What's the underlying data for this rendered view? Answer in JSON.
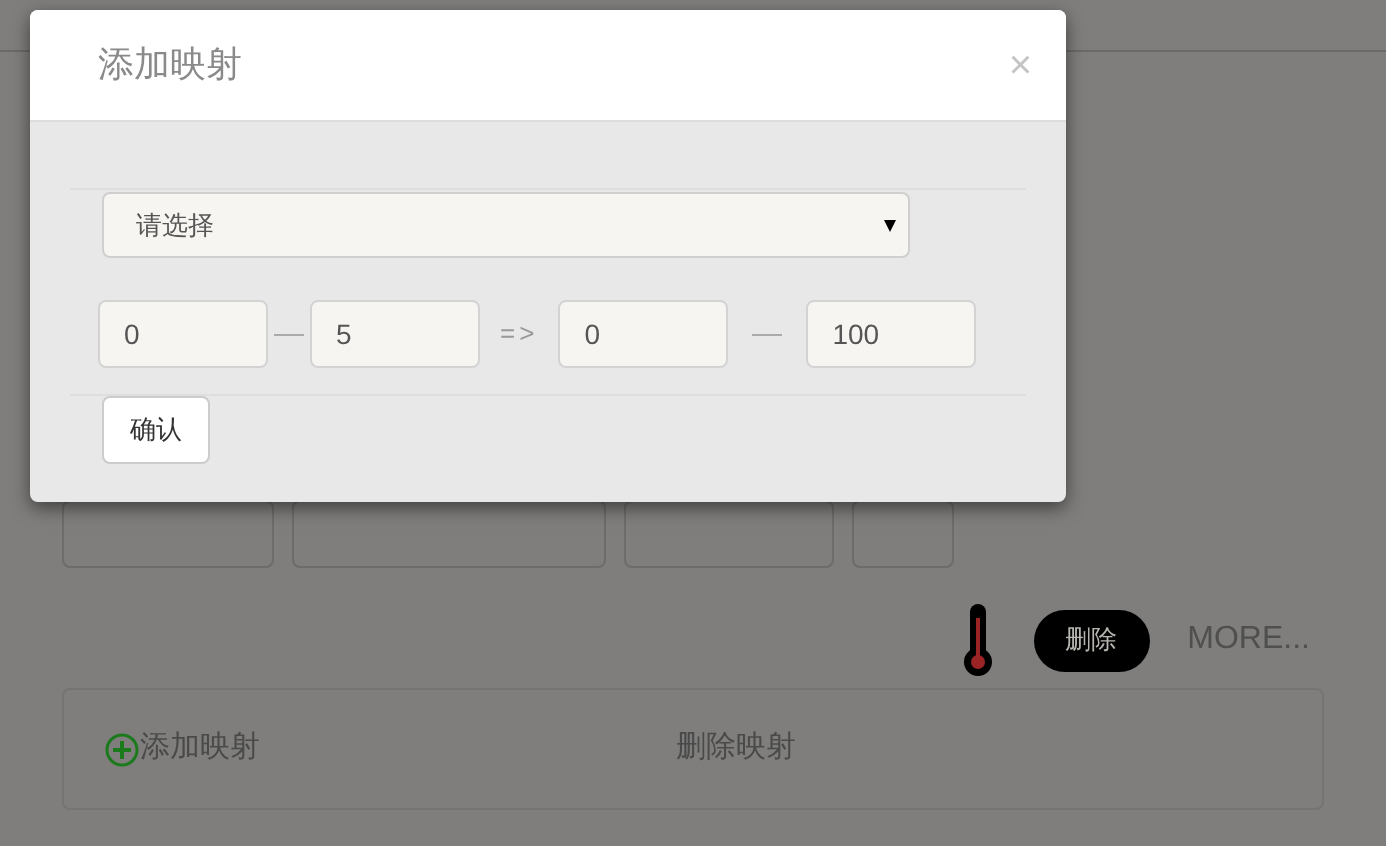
{
  "page": {
    "actions": {
      "delete_button": "删除",
      "more_link": "MORE..."
    },
    "mapping_panel": {
      "add": "添加映射",
      "remove": "删除映射"
    }
  },
  "dialog": {
    "title": "添加映射",
    "close": "×",
    "select": {
      "value": "请选择"
    },
    "range": {
      "from_min": "0",
      "from_max": "5",
      "arrow": "=>",
      "to_min": "0",
      "to_max": "100"
    },
    "confirm": "确认"
  }
}
